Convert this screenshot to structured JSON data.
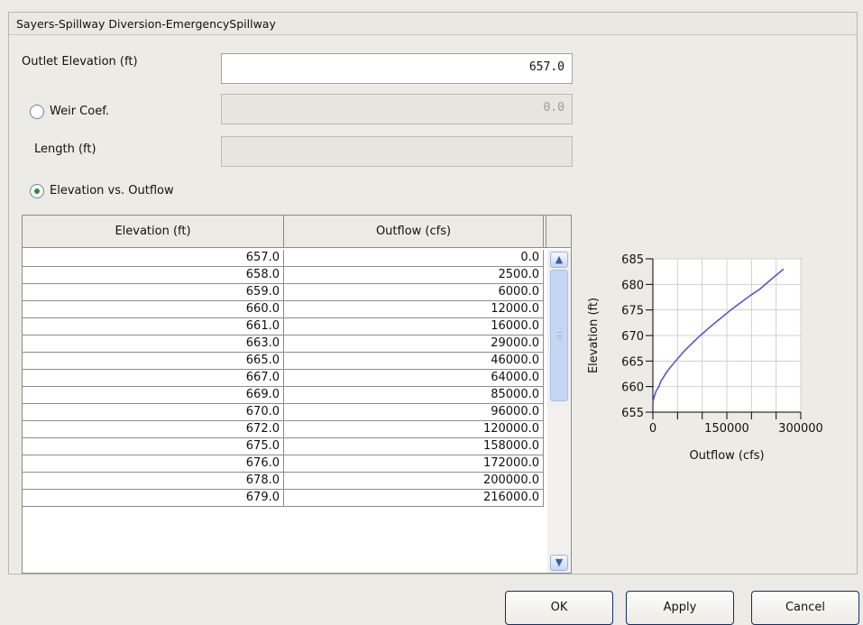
{
  "dialog": {
    "title": "Sayers-Spillway Diversion-EmergencySpillway"
  },
  "form": {
    "outlet_elevation_label": "Outlet Elevation (ft)",
    "outlet_elevation_value": "657.0",
    "weir_coef_label": "Weir Coef.",
    "weir_coef_value": "0.0",
    "weir_coef_selected": false,
    "length_label": "Length (ft)",
    "length_value": "",
    "elev_vs_outflow_label": "Elevation vs. Outflow",
    "elev_vs_outflow_selected": true
  },
  "table": {
    "columns": [
      "Elevation (ft)",
      "Outflow (cfs)"
    ],
    "rows": [
      [
        "657.0",
        "0.0"
      ],
      [
        "658.0",
        "2500.0"
      ],
      [
        "659.0",
        "6000.0"
      ],
      [
        "660.0",
        "12000.0"
      ],
      [
        "661.0",
        "16000.0"
      ],
      [
        "663.0",
        "29000.0"
      ],
      [
        "665.0",
        "46000.0"
      ],
      [
        "667.0",
        "64000.0"
      ],
      [
        "669.0",
        "85000.0"
      ],
      [
        "670.0",
        "96000.0"
      ],
      [
        "672.0",
        "120000.0"
      ],
      [
        "675.0",
        "158000.0"
      ],
      [
        "676.0",
        "172000.0"
      ],
      [
        "678.0",
        "200000.0"
      ],
      [
        "679.0",
        "216000.0"
      ]
    ]
  },
  "chart_data": {
    "type": "line",
    "xlabel": "Outflow (cfs)",
    "ylabel": "Elevation (ft)",
    "xlim": [
      0,
      300000
    ],
    "ylim": [
      655,
      685
    ],
    "xticks": [
      "0",
      "150000",
      "300000"
    ],
    "yticks": [
      "655",
      "660",
      "665",
      "670",
      "675",
      "680",
      "685"
    ],
    "grid": true,
    "line_color": "#4b4bdc",
    "x": [
      0,
      2500,
      6000,
      12000,
      16000,
      29000,
      46000,
      64000,
      85000,
      96000,
      120000,
      158000,
      172000,
      200000,
      216000,
      240000,
      265000
    ],
    "y": [
      657,
      658,
      659,
      660,
      661,
      663,
      665,
      667,
      669,
      670,
      672,
      675,
      676,
      678,
      679,
      681,
      683
    ]
  },
  "buttons": {
    "ok": "OK",
    "apply": "Apply",
    "cancel": "Cancel"
  },
  "scroll": {
    "up": "▲",
    "down": "▼"
  }
}
